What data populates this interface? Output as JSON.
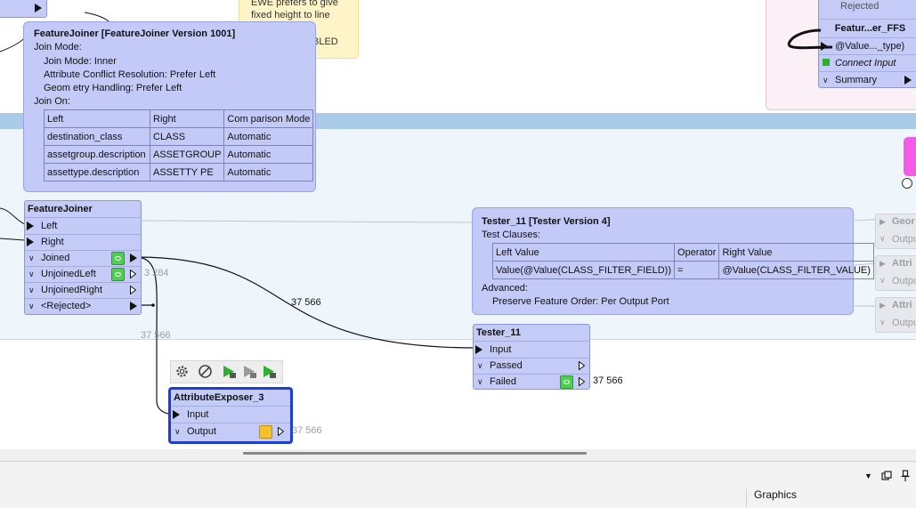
{
  "notes": {
    "line1": "EWE prefers to give",
    "line2": "fixed height to line",
    "line3": "BLED"
  },
  "feature_ffs": {
    "title": "Featur...er_FFS",
    "port_value": "@Value..._type)",
    "connect_input": "Connect Input",
    "summary": "Summary",
    "rejected_partial": "Rejected"
  },
  "joiner_tip": {
    "title": "FeatureJoiner [FeatureJoiner Version 1001]",
    "join_mode_label": "Join Mode:",
    "join_mode": "Join Mode: Inner",
    "conflict": "Attribute Conflict Resolution: Prefer Left",
    "geometry": "Geom etry Handling: Prefer Left",
    "join_on_label": "Join On:",
    "columns": [
      "Left",
      "Right",
      "Com parison Mode"
    ],
    "rows": [
      [
        "destination_class",
        "CLASS",
        "Automatic"
      ],
      [
        "assetgroup.description",
        "ASSETGROUP",
        "Automatic"
      ],
      [
        "assettype.description",
        "ASSETTY PE",
        "Automatic"
      ]
    ]
  },
  "feature_joiner": {
    "title": "FeatureJoiner",
    "inputs": [
      "Left",
      "Right"
    ],
    "outputs": [
      "Joined",
      "UnjoinedLeft",
      "UnjoinedRight",
      "<Rejected>"
    ]
  },
  "tester_tip": {
    "title": "Tester_11 [Tester Version 4]",
    "clauses_label": "Test Clauses:",
    "columns": [
      "Left Value",
      "Operator",
      "Right Value"
    ],
    "rows": [
      [
        "Value(@Value(CLASS_FILTER_FIELD))",
        "=",
        "@Value(CLASS_FILTER_VALUE)"
      ]
    ],
    "advanced_label": "Advanced:",
    "advanced": "Preserve Feature Order: Per Output Port"
  },
  "tester": {
    "title": "Tester_11",
    "input": "Input",
    "outputs": [
      "Passed",
      "Failed"
    ]
  },
  "exposer": {
    "title": "AttributeExposer_3",
    "input": "Input",
    "output": "Output"
  },
  "ghost_nodes": [
    {
      "title": "Geor",
      "port": "Outpu"
    },
    {
      "title": "Attri",
      "port": "Outpu"
    },
    {
      "title": "Attri",
      "port": "Outpu"
    }
  ],
  "counts": {
    "unjoined_left": "3 284",
    "joined_link": "37 566",
    "rejected_link": "37 566",
    "failed": "37 566",
    "exposer_output": "37 566"
  },
  "bottom_panel": {
    "graphics_label": "Graphics"
  },
  "colors": {
    "node_fill": "#c4cbf7",
    "bookmark_band": "#aacbe8",
    "selected_border": "#1e3cd8",
    "eye_green": "#4fcf4f"
  }
}
